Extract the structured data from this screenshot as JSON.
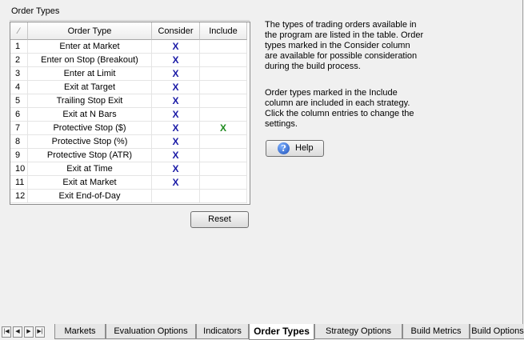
{
  "group_title": "Order Types",
  "table": {
    "headers": {
      "corner": "⁄",
      "type": "Order Type",
      "consider": "Consider",
      "include": "Include"
    },
    "rows": [
      {
        "num": "1",
        "type": "Enter at Market",
        "consider": "X",
        "include": ""
      },
      {
        "num": "2",
        "type": "Enter on Stop (Breakout)",
        "consider": "X",
        "include": ""
      },
      {
        "num": "3",
        "type": "Enter at Limit",
        "consider": "X",
        "include": ""
      },
      {
        "num": "4",
        "type": "Exit at Target",
        "consider": "X",
        "include": ""
      },
      {
        "num": "5",
        "type": "Trailing Stop Exit",
        "consider": "X",
        "include": ""
      },
      {
        "num": "6",
        "type": "Exit at N Bars",
        "consider": "X",
        "include": ""
      },
      {
        "num": "7",
        "type": "Protective Stop ($)",
        "consider": "X",
        "include": "X"
      },
      {
        "num": "8",
        "type": "Protective Stop (%)",
        "consider": "X",
        "include": ""
      },
      {
        "num": "9",
        "type": "Protective Stop (ATR)",
        "consider": "X",
        "include": ""
      },
      {
        "num": "10",
        "type": "Exit at Time",
        "consider": "X",
        "include": ""
      },
      {
        "num": "11",
        "type": "Exit at Market",
        "consider": "X",
        "include": ""
      },
      {
        "num": "12",
        "type": "Exit End-of-Day",
        "consider": "",
        "include": ""
      }
    ]
  },
  "buttons": {
    "reset": "Reset",
    "help": "Help"
  },
  "description": {
    "p1": "The types of trading orders available in the program are listed in the table. Order types marked in the Consider column are available for possible consideration during the build process.",
    "p2": "Order types marked in the Include column are included in each strategy. Click the column entries to change the settings."
  },
  "tabs": [
    "Markets",
    "Evaluation Options",
    "Indicators",
    "Order Types",
    "Strategy Options",
    "Build Metrics",
    "Build Options"
  ],
  "active_tab": "Order Types",
  "colors": {
    "consider_mark": "#1a1aa6",
    "include_mark": "#1e8a1e"
  }
}
